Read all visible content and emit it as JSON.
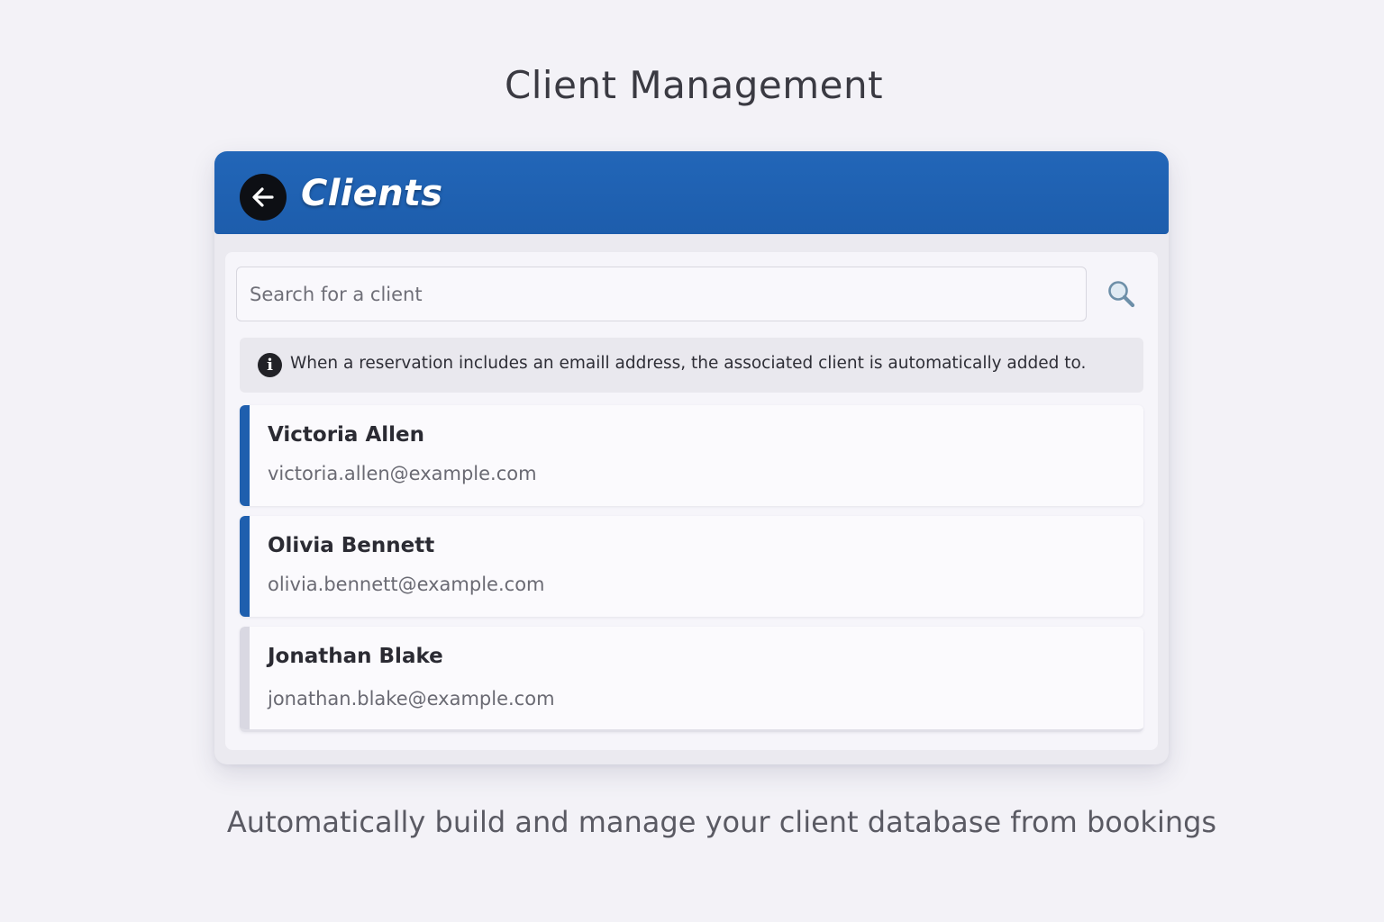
{
  "page": {
    "heading": "Client Management",
    "tagline": "Automatically build and manage your client database from bookings"
  },
  "header": {
    "title": "Clients",
    "back_icon": "arrow-left-icon",
    "color": "#1f5fae"
  },
  "search": {
    "placeholder": "Search for a client",
    "value": "",
    "icon": "magnifier-icon"
  },
  "info": {
    "icon": "info-icon",
    "text": "When a reservation includes an emaill address, the associated client is automatically added to."
  },
  "clients": [
    {
      "name": "Victoria Allen",
      "email": "victoria.allen@example.com",
      "accent_color": "#1f5fae"
    },
    {
      "name": "Olivia Bennett",
      "email": "olivia.bennett@example.com",
      "accent_color": "#1f5fae"
    },
    {
      "name": "Jonathan Blake",
      "email": "jonathan.blake@example.com",
      "accent_color": "#d9d8e2"
    }
  ]
}
